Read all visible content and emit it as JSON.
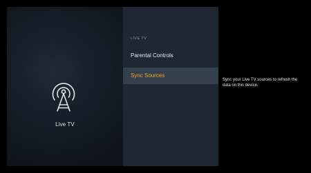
{
  "category": {
    "label": "Live TV",
    "icon": "antenna-icon"
  },
  "menu": {
    "section_header": "LIVE TV",
    "items": [
      {
        "label": "Parental Controls",
        "selected": false
      },
      {
        "label": "Sync Sources",
        "selected": true
      }
    ]
  },
  "detail": {
    "description": "Sync your Live TV sources to refresh the data on this device."
  },
  "colors": {
    "background": "#000000",
    "left_panel": "#121a22",
    "menu_panel": "#1d2833",
    "selected_row": "#32404d",
    "accent": "#f5a623",
    "text": "#e6e6e6",
    "muted_text": "#8c97a3"
  }
}
